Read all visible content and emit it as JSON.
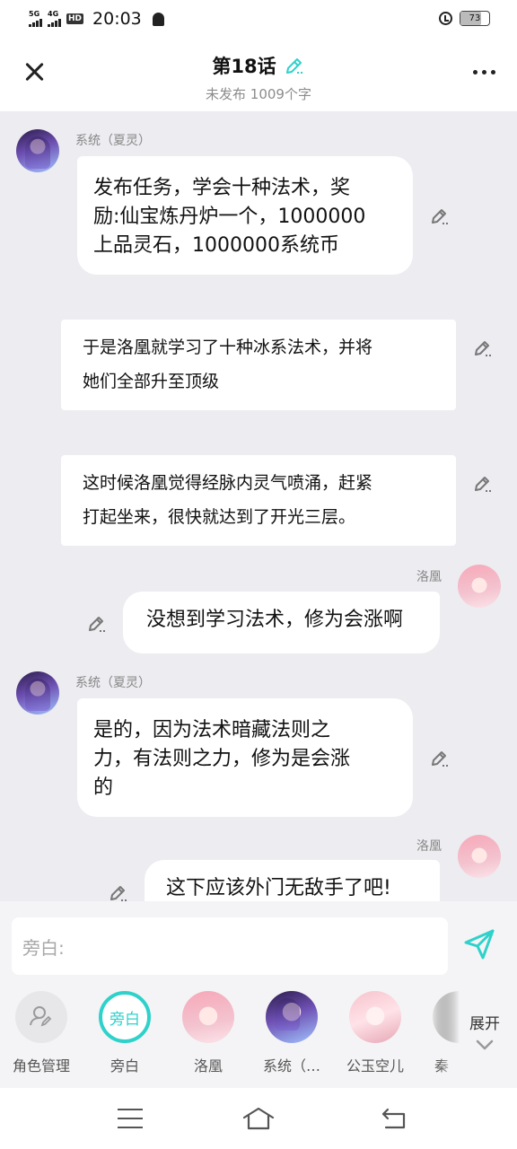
{
  "status_bar": {
    "net1": "5G",
    "net2": "4G",
    "hd": "HD",
    "time": "20:03",
    "battery": "73"
  },
  "header": {
    "title": "第18话",
    "subtitle": "未发布 1009个字"
  },
  "messages": [
    {
      "speaker": "系统（夏灵）",
      "side": "left",
      "text": "发布任务，学会十种法术，奖\n励:仙宝炼丹炉一个，1000000\n上品灵石，1000000系统币"
    },
    {
      "speaker": "",
      "side": "narration",
      "text": "于是洛凰就学习了十种冰系法术，并将\n她们全部升至顶级"
    },
    {
      "speaker": "",
      "side": "narration",
      "text": "这时候洛凰觉得经脉内灵气喷涌，赶紧\n打起坐来，很快就达到了开光三层。"
    },
    {
      "speaker": "洛凰",
      "side": "right",
      "text": "没想到学习法术，修为会涨啊"
    },
    {
      "speaker": "系统（夏灵）",
      "side": "left",
      "text": "是的，因为法术暗藏法则之\n力，有法则之力，修为是会涨\n的"
    },
    {
      "speaker": "洛凰",
      "side": "right",
      "text": "这下应该外门无敌手了吧!"
    }
  ],
  "input": {
    "placeholder": "旁白:"
  },
  "roles": [
    {
      "label": "角色管理",
      "icon": "user-edit-icon"
    },
    {
      "label": "旁白",
      "badge": "旁白"
    },
    {
      "label": "洛凰"
    },
    {
      "label": "系统（…"
    },
    {
      "label": "公玉空儿"
    },
    {
      "label": "秦"
    }
  ],
  "expand_label": "展开",
  "colors": {
    "accent": "#2fd1cb",
    "background": "#ececf1",
    "bubble": "#ffffff"
  }
}
